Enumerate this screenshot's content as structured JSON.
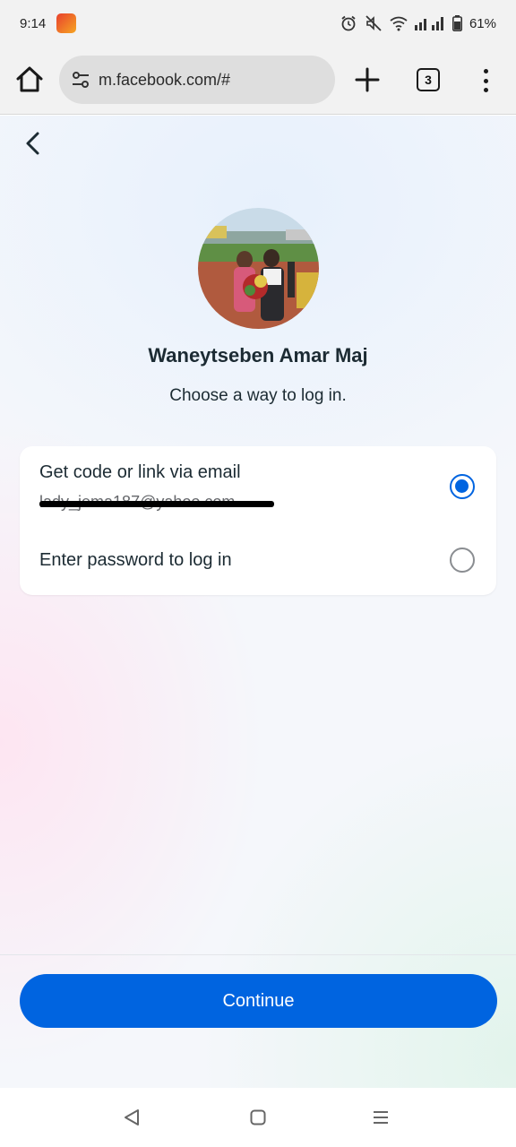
{
  "status_bar": {
    "time": "9:14",
    "battery": "61%"
  },
  "browser": {
    "url": "m.facebook.com/#",
    "tab_count": "3"
  },
  "page": {
    "user_name": "Waneytseben Amar Maj",
    "subtitle": "Choose a way to log in.",
    "options": [
      {
        "label": "Get code or link via email",
        "detail": "lady_jema187@yahoo.com",
        "selected": true
      },
      {
        "label": "Enter password to log in",
        "selected": false
      }
    ],
    "continue_label": "Continue"
  },
  "colors": {
    "accent": "#0064e0",
    "text": "#1c2b33"
  },
  "icons": [
    "home-icon",
    "tune-icon",
    "plus-icon",
    "tabs-icon",
    "more-vert-icon",
    "back-icon",
    "alarm-icon",
    "mute-icon",
    "wifi-icon",
    "signal-icon",
    "battery-icon",
    "nav-back-icon",
    "nav-home-icon",
    "nav-recent-icon"
  ]
}
